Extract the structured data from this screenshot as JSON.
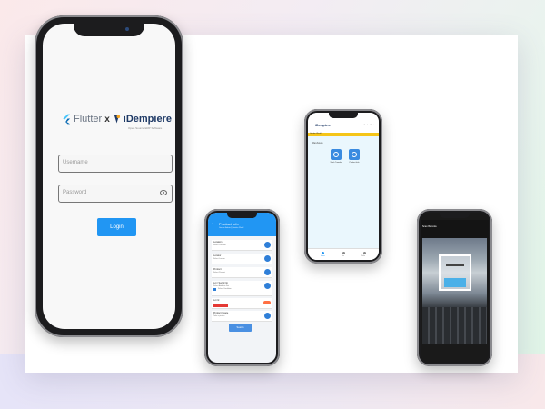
{
  "login": {
    "brand_flutter": "Flutter",
    "brand_x": "x",
    "brand_idempiere": "iDempiere",
    "brand_tagline": "Open Source ERP Software",
    "username_placeholder": "Username",
    "password_placeholder": "Password",
    "login_button": "Login"
  },
  "product": {
    "title": "Product Info",
    "subtitle": "Garden Admin@Garden World",
    "rows": [
      {
        "label": "Location",
        "value": "Select Location"
      },
      {
        "label": "Locator",
        "value": "Select Locator"
      },
      {
        "label": "Product",
        "value": "Select Product"
      },
      {
        "label": "Lot / Serial No",
        "value": "Select Attribute Set",
        "extra": "Select Condition"
      },
      {
        "label": "Lot Id",
        "value": ""
      },
      {
        "label": "Product Image",
        "value": "Take a picture"
      }
    ],
    "button": "Search"
  },
  "home": {
    "brand": "iDempiere",
    "right_text": "GardenAdmin",
    "banner": "Garden World",
    "section": "Warehouse",
    "tiles": [
      "Stock Transfer",
      "Product Info"
    ],
    "nav": [
      "Home",
      "Info",
      "Profile"
    ]
  },
  "scanner": {
    "title": "Scan Barcode"
  },
  "colors": {
    "accent": "#2196f3",
    "banner": "#f5c518",
    "warning": "#e53935"
  }
}
